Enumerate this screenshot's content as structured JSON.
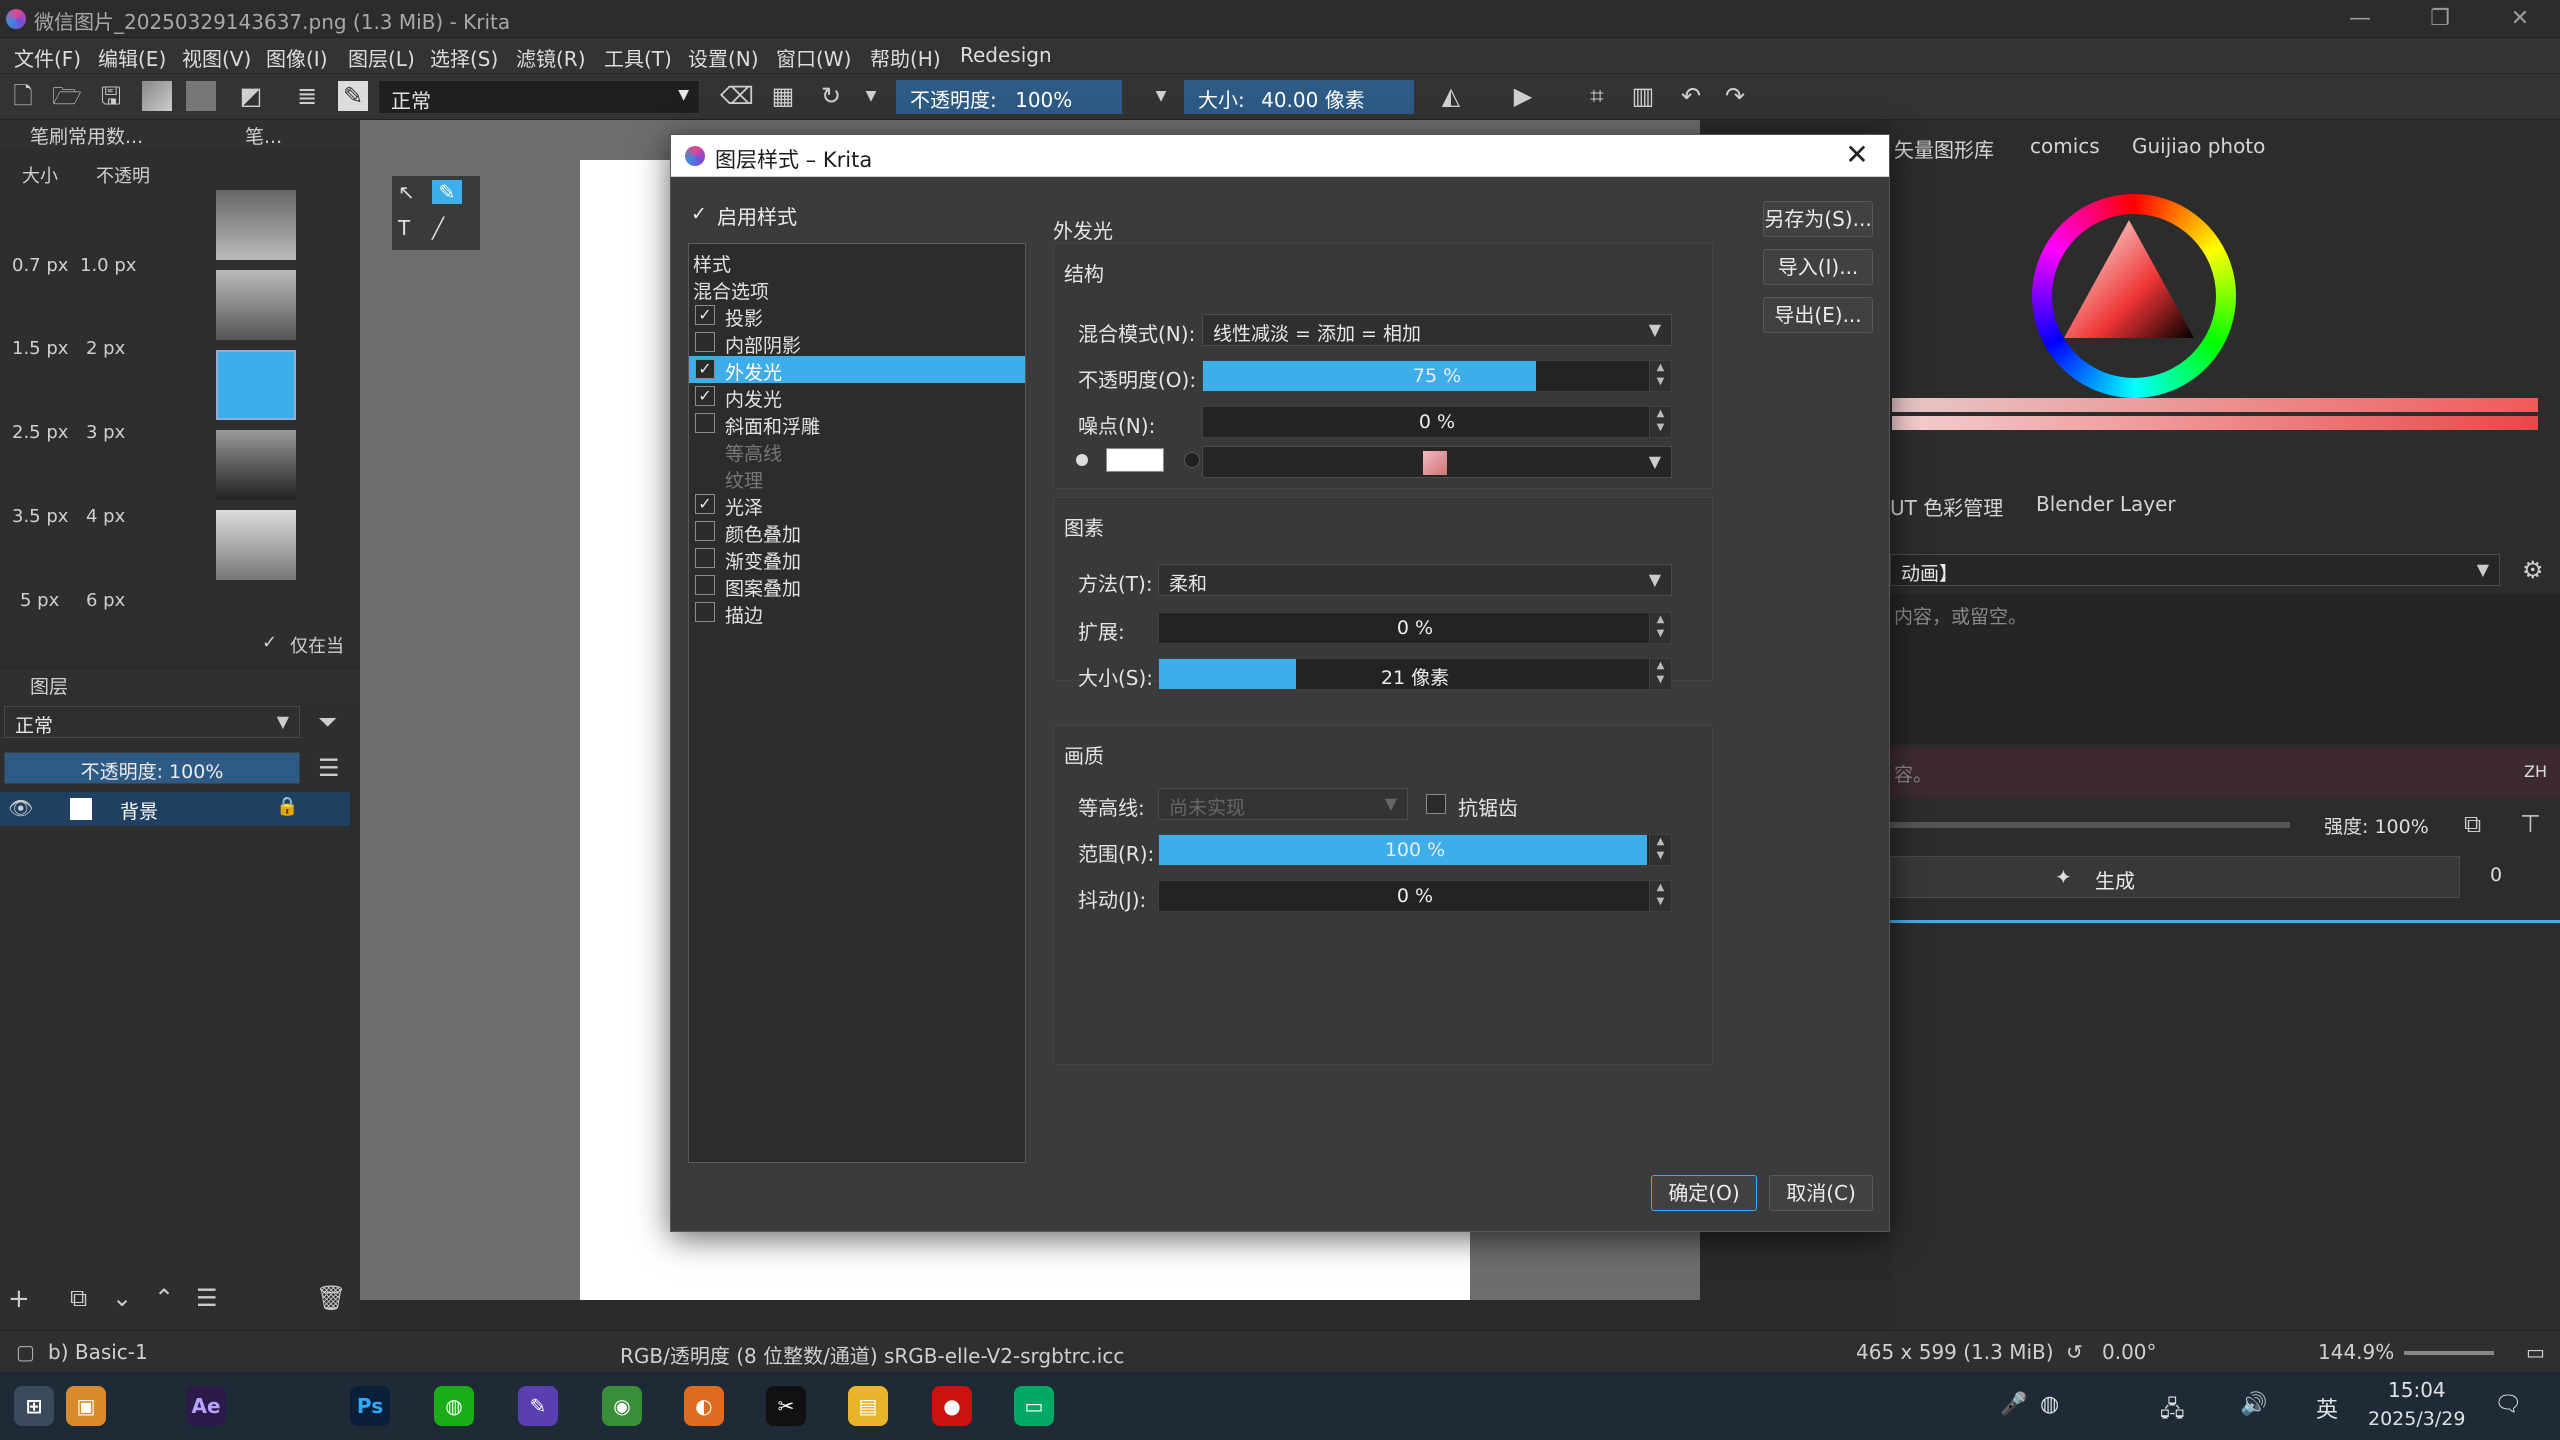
{
  "window": {
    "title": "微信图片_20250329143637.png (1.3 MiB) - Krita",
    "minimize": "—",
    "restore": "❐",
    "close": "✕"
  },
  "menu": [
    "文件(F)",
    "编辑(E)",
    "视图(V)",
    "图像(I)",
    "图层(L)",
    "选择(S)",
    "滤镜(R)",
    "工具(T)",
    "设置(N)",
    "窗口(W)",
    "帮助(H)",
    "Redesign"
  ],
  "toolbar": {
    "blend_mode": "正常",
    "opacity_label": "不透明度:",
    "opacity_value": "100%",
    "size_label": "大小:",
    "size_value": "40.00 像素"
  },
  "brush_docker": {
    "title": "笔刷常用数...",
    "title2": "笔...",
    "tab_size": "大小",
    "tab_opacity": "不透明",
    "sizes": [
      "0.7 px",
      "1.0 px",
      "1.5 px",
      "2 px",
      "2.5 px",
      "3 px",
      "3.5 px",
      "4 px",
      "5 px",
      "6 px"
    ],
    "only_current": "仅在当"
  },
  "layers_docker": {
    "title": "图层",
    "blend": "正常",
    "opacity": "不透明度: 100%",
    "layer_name": "背景"
  },
  "right_dock": {
    "tabs_top": [
      "矢量图形库",
      "comics",
      "Guijiao photo"
    ],
    "tabs_mid": [
      "UT 色彩管理",
      "Blender Layer"
    ],
    "anim_combo": "动画】",
    "placeholder": "内容，或留空。",
    "placeholder2": "容。",
    "lang": "ZH",
    "strength": "强度: 100%",
    "generate": "生成",
    "count": "0"
  },
  "dialog": {
    "title": "图层样式 – Krita",
    "enable_styles": "启用样式",
    "list": [
      {
        "label": "样式",
        "checkbox": false,
        "checked": false,
        "selected": false,
        "disabled": false
      },
      {
        "label": "混合选项",
        "checkbox": false,
        "checked": false,
        "selected": false,
        "disabled": false
      },
      {
        "label": "投影",
        "checkbox": true,
        "checked": true,
        "selected": false,
        "disabled": false
      },
      {
        "label": "内部阴影",
        "checkbox": true,
        "checked": false,
        "selected": false,
        "disabled": false
      },
      {
        "label": "外发光",
        "checkbox": true,
        "checked": true,
        "selected": true,
        "disabled": false
      },
      {
        "label": "内发光",
        "checkbox": true,
        "checked": true,
        "selected": false,
        "disabled": false
      },
      {
        "label": "斜面和浮雕",
        "checkbox": true,
        "checked": false,
        "selected": false,
        "disabled": false
      },
      {
        "label": "等高线",
        "checkbox": false,
        "checked": false,
        "selected": false,
        "disabled": true
      },
      {
        "label": "纹理",
        "checkbox": false,
        "checked": false,
        "selected": false,
        "disabled": true
      },
      {
        "label": "光泽",
        "checkbox": true,
        "checked": true,
        "selected": false,
        "disabled": false
      },
      {
        "label": "颜色叠加",
        "checkbox": true,
        "checked": false,
        "selected": false,
        "disabled": false
      },
      {
        "label": "渐变叠加",
        "checkbox": true,
        "checked": false,
        "selected": false,
        "disabled": false
      },
      {
        "label": "图案叠加",
        "checkbox": true,
        "checked": false,
        "selected": false,
        "disabled": false
      },
      {
        "label": "描边",
        "checkbox": true,
        "checked": false,
        "selected": false,
        "disabled": false
      }
    ],
    "section_title": "外发光",
    "structure": {
      "title": "结构",
      "blend_label": "混合模式(N):",
      "blend_value": "线性减淡 = 添加 = 相加",
      "opacity_label": "不透明度(O):",
      "opacity_value": "75 %",
      "opacity_fraction": 0.75,
      "noise_label": "噪点(N):",
      "noise_value": "0 %"
    },
    "elements": {
      "title": "图素",
      "method_label": "方法(T):",
      "method_value": "柔和",
      "spread_label": "扩展:",
      "spread_value": "0 %",
      "size_label": "大小(S):",
      "size_value": "21 像素",
      "size_fraction": 0.28
    },
    "quality": {
      "title": "画质",
      "contour_label": "等高线:",
      "contour_value": "尚未实现",
      "antialias": "抗锯齿",
      "range_label": "范围(R):",
      "range_value": "100 %",
      "range_fraction": 1.0,
      "jitter_label": "抖动(J):",
      "jitter_value": "0 %"
    },
    "buttons": {
      "save_as": "另存为(S)...",
      "import": "导入(I)...",
      "export": "导出(E)...",
      "ok": "确定(O)",
      "cancel": "取消(C)"
    }
  },
  "status": {
    "brush": "b) Basic-1",
    "colorspace": "RGB/透明度 (8 位整数/通道)  sRGB-elle-V2-srgbtrc.icc",
    "dims": "465 x 599 (1.3 MiB)",
    "rotation": "0.00°",
    "zoom": "144.9%"
  },
  "taskbar": {
    "apps": [
      "Ae",
      "Ps"
    ],
    "ime": "英",
    "time": "15:04",
    "date": "2025/3/29"
  }
}
